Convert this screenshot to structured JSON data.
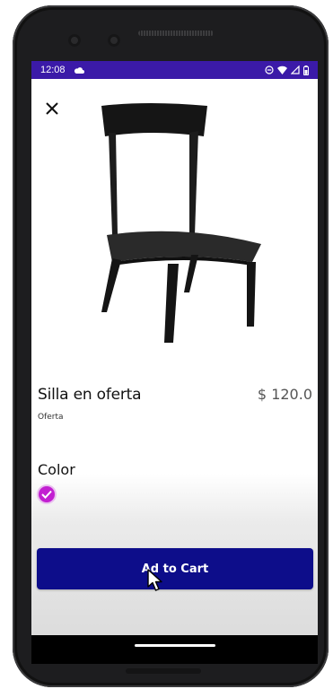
{
  "status_bar": {
    "time": "12:08",
    "background_color": "#3b1aa8",
    "icons": [
      "cloud-icon",
      "do-not-disturb-icon",
      "wifi-icon",
      "signal-icon",
      "battery-icon"
    ]
  },
  "header": {
    "close_icon": "close-icon"
  },
  "product": {
    "image": "black-chair-image",
    "name": "Silla en oferta",
    "price": "$ 120.0",
    "category": "Oferta"
  },
  "color_section": {
    "heading": "Color",
    "selected_color": "#c21fd1"
  },
  "actions": {
    "add_to_cart_label": "Ad to Cart",
    "button_color": "#0d0d8a"
  }
}
